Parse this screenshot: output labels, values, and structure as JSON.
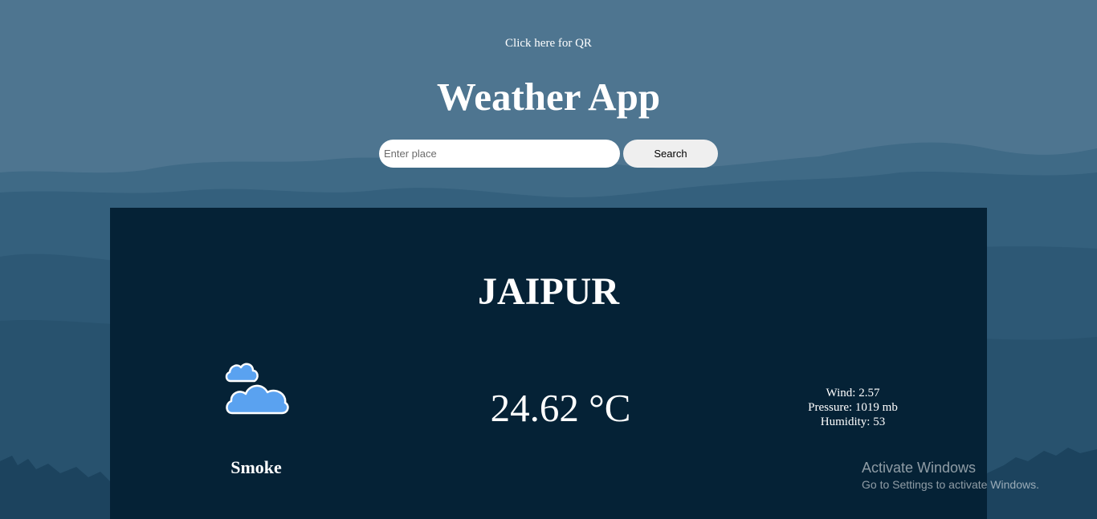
{
  "header": {
    "qr_link": "Click here for QR",
    "title": "Weather App"
  },
  "search": {
    "placeholder": "Enter place",
    "value": "",
    "button_label": "Search"
  },
  "weather": {
    "city": "JAIPUR",
    "icon": "cloud-icon",
    "condition": "Smoke",
    "temperature": "24.62 °C",
    "wind": "Wind: 2.57",
    "pressure": "Pressure: 1019 mb",
    "humidity": "Humidity: 53"
  },
  "watermark": {
    "title": "Activate Windows",
    "subtitle": "Go to Settings to activate Windows."
  },
  "colors": {
    "sky": "#4e7590",
    "card": "#052236",
    "cloud_fill": "#5aa2f0"
  }
}
